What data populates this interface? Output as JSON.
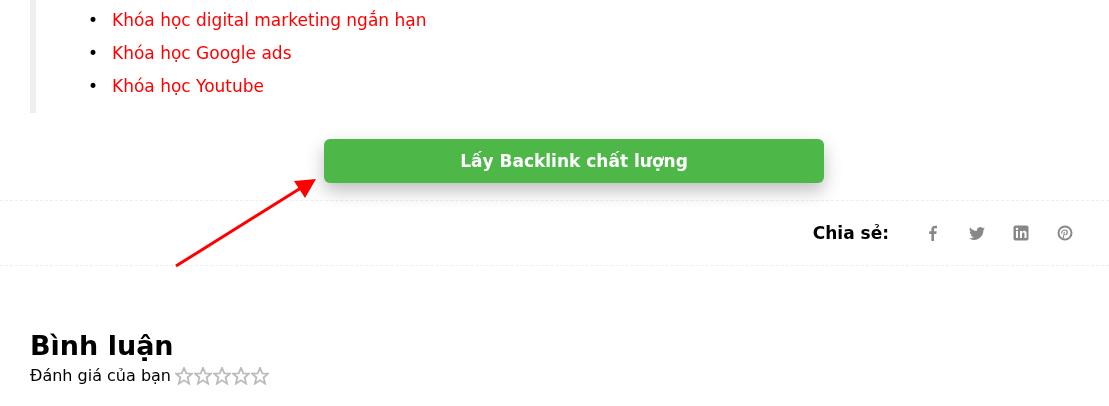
{
  "links": [
    {
      "bullet": "•",
      "text": "Khóa học digital marketing ngắn hạn"
    },
    {
      "bullet": "•",
      "text": "Khóa học Google ads"
    },
    {
      "bullet": "•",
      "text": "Khóa học Youtube"
    }
  ],
  "cta_button": {
    "label": "Lấy Backlink chất lượng"
  },
  "share": {
    "label": "Chia sẻ:",
    "icons": [
      {
        "kind": "facebook"
      },
      {
        "kind": "twitter"
      },
      {
        "kind": "linkedin"
      },
      {
        "kind": "pinterest"
      }
    ]
  },
  "comments": {
    "title": "Bình luận",
    "rating_label": "Đánh giá của bạn",
    "stars": 0
  }
}
